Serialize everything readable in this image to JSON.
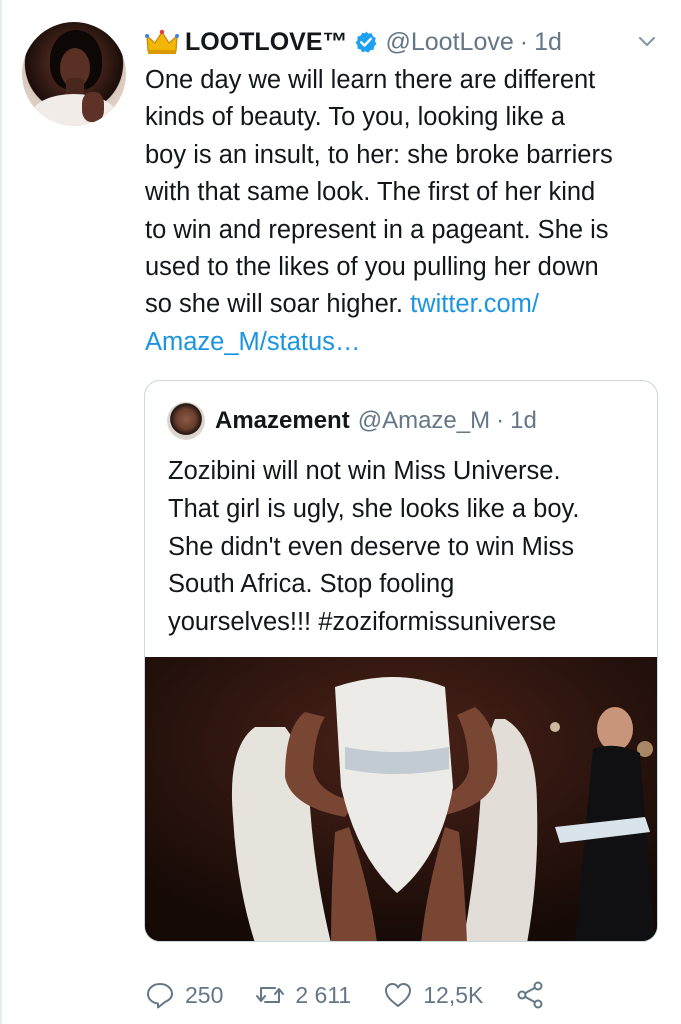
{
  "tweet": {
    "display_name": "LOOTLOVE™",
    "handle": "@LootLove",
    "separator": "·",
    "time": "1d",
    "text_lines": [
      "One day we will learn there are different",
      "kinds of beauty. To you, looking like a",
      "boy is an insult, to her: she broke barriers",
      "with that same look. The first of her kind",
      "to win and represent in a pageant. She is",
      "used to the likes of you pulling her down",
      "so she will soar higher."
    ],
    "link_part1": "twitter.com/",
    "link_part2": "Amaze_M/status…"
  },
  "quote": {
    "display_name": "Amazement",
    "handle": "@Amaze_M",
    "separator": "·",
    "time": "1d",
    "text_lines": [
      "Zozibini will not win Miss Universe.",
      "That girl is ugly, she looks like a boy.",
      "She didn't even deserve to win Miss",
      "South Africa. Stop fooling",
      "yourselves!!! #zoziformissuniverse"
    ]
  },
  "actions": {
    "replies": "250",
    "retweets": "2 611",
    "likes": "12,5K"
  },
  "colors": {
    "link": "#1b95e0",
    "secondary": "#657786",
    "verified": "#1da1f2",
    "border": "#ccd6dd"
  },
  "icons": [
    "crown-icon",
    "verified-badge-icon",
    "chevron-down-icon",
    "reply-icon",
    "retweet-icon",
    "like-icon",
    "share-icon"
  ]
}
